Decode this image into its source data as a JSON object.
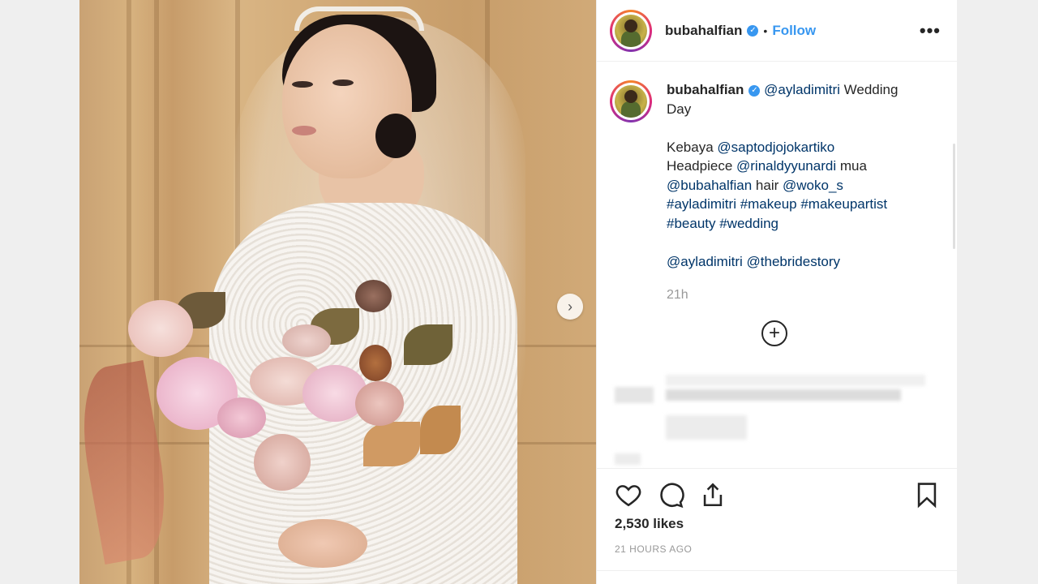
{
  "post": {
    "username": "bubahalfian",
    "verified_icon": "verified-badge-icon",
    "separator": "•",
    "follow_label": "Follow",
    "more_label": "•••"
  },
  "caption": {
    "username": "bubahalfian",
    "mention_main": "@ayladimitri",
    "title_text": "Wedding Day",
    "line_kebaya": "Kebaya",
    "mention_kebaya": "@saptodjojokartiko",
    "line_headpiece": "Headpiece",
    "mention_headpiece": "@rinaldyyunardi",
    "line_mua": "mua",
    "mention_mua": "@bubahalfian",
    "line_hair": "hair",
    "mention_hair": "@woko_s",
    "tags_line1": "#ayladimitri #makeup #makeupartist",
    "tags_line2": "#beauty #wedding",
    "mention_a": "@ayladimitri",
    "mention_b": "@thebridestory",
    "time": "21h"
  },
  "load_more_icon": "plus-circle-icon",
  "actions": {
    "like_icon": "heart-icon",
    "comment_icon": "comment-icon",
    "share_icon": "share-icon",
    "save_icon": "bookmark-icon",
    "likes": "2,530 likes",
    "posted_ago": "21 HOURS AGO"
  },
  "colors": {
    "link": "#003569",
    "follow": "#3897f0",
    "muted": "#999999"
  }
}
